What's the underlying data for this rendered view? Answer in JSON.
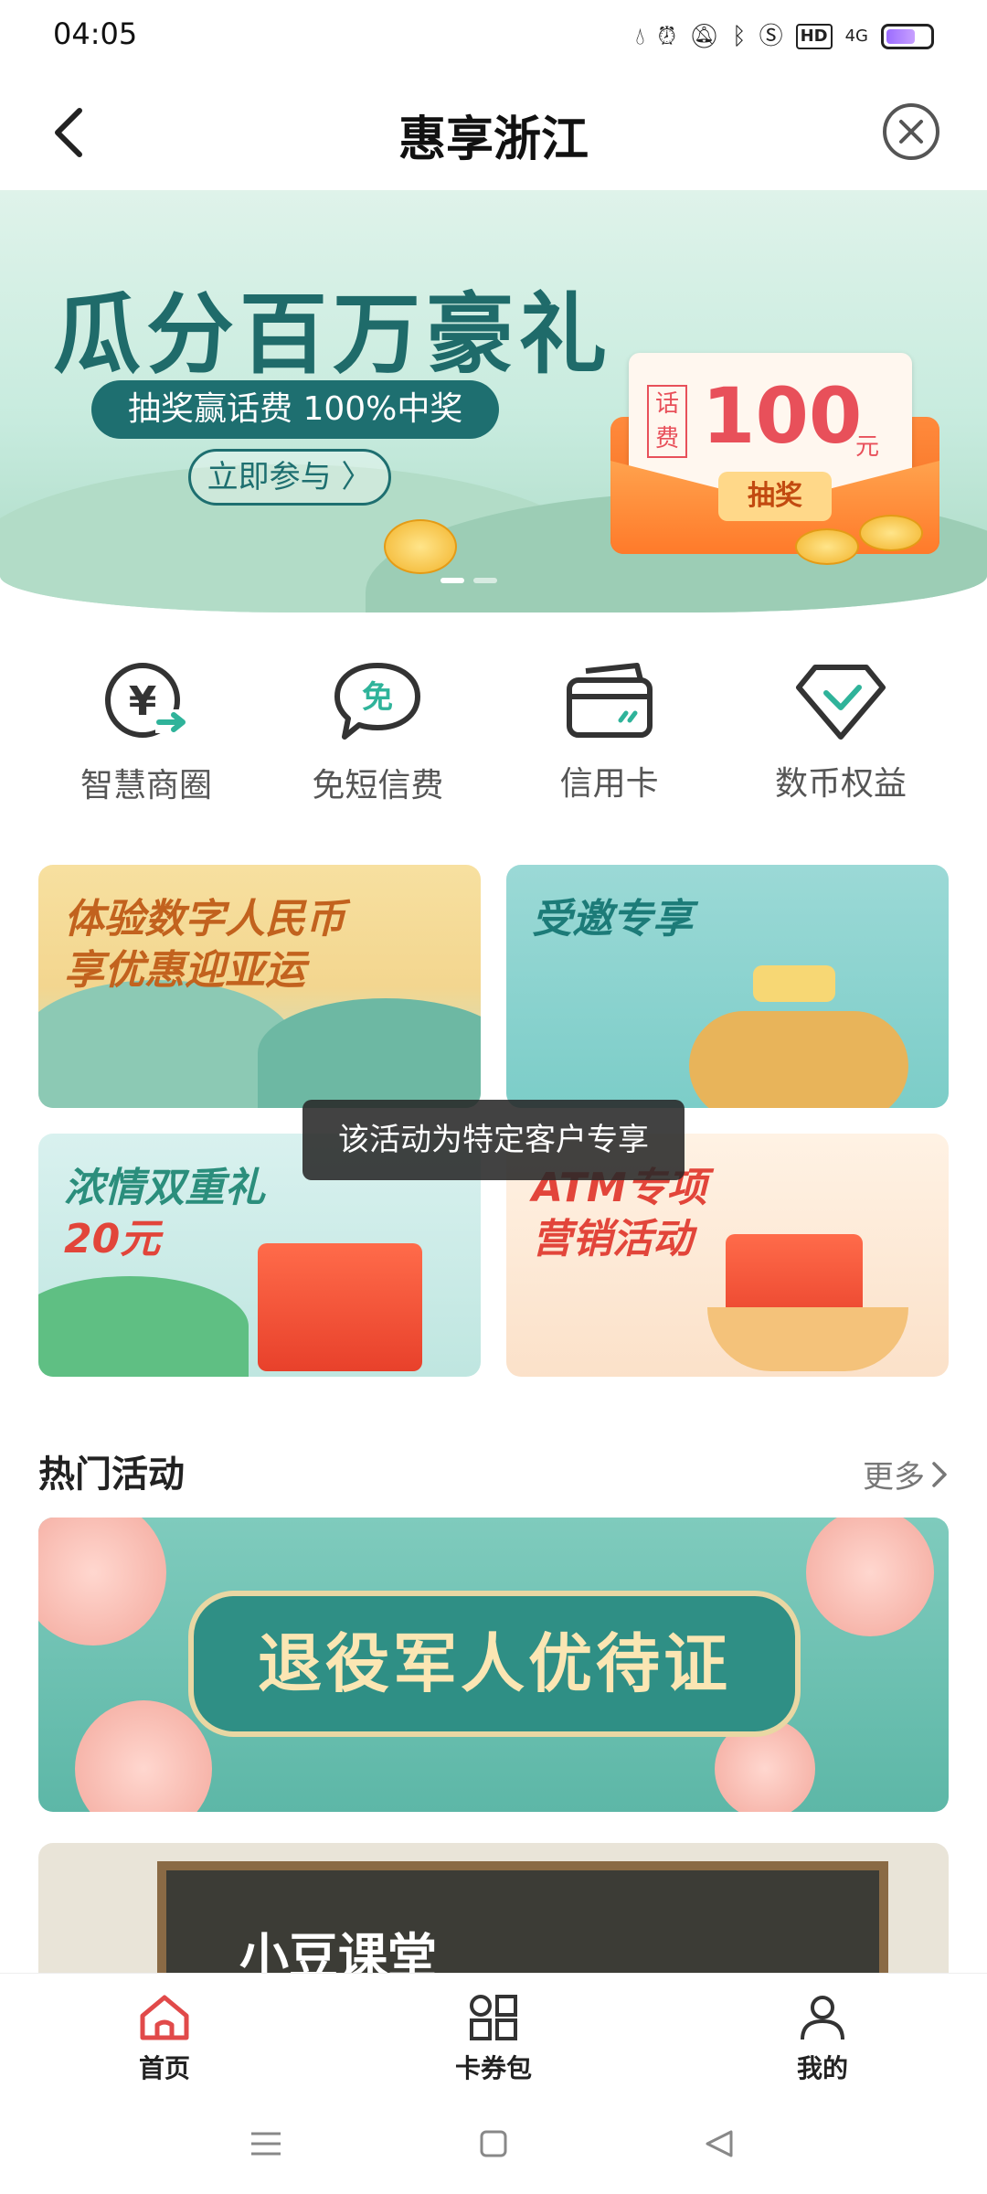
{
  "status_bar": {
    "time": "04:05",
    "network": "4G"
  },
  "nav": {
    "title": "惠享浙江"
  },
  "hero": {
    "title": "瓜分百万豪礼",
    "subtitle": "抽奖赢话费 100%中奖",
    "cta": "立即参与 〉",
    "voucher_tag": "话费",
    "voucher_amount": "100",
    "voucher_unit": "元",
    "voucher_button": "抽奖",
    "active_dot": 0
  },
  "quick_entries": [
    {
      "label": "智慧商圈",
      "icon": "yuan-arrow-icon"
    },
    {
      "label": "免短信费",
      "icon": "free-sms-icon"
    },
    {
      "label": "信用卡",
      "icon": "credit-card-icon"
    },
    {
      "label": "数币权益",
      "icon": "diamond-icon"
    }
  ],
  "promo_cards": [
    {
      "line1": "体验数字人民币",
      "line2": "享优惠迎亚运"
    },
    {
      "line1": "受邀专享",
      "line2": ""
    },
    {
      "line1": "浓情双重礼",
      "line2": "20元"
    },
    {
      "line1": "ATM专项",
      "line2": "营销活动"
    }
  ],
  "toast": "该活动为特定客户专享",
  "hot_section": {
    "title": "热门活动",
    "more": "更多",
    "banner1_text": "退役军人优待证",
    "banner2_text": "小豆课堂"
  },
  "tabbar": [
    {
      "label": "首页",
      "icon": "home-icon",
      "active": true
    },
    {
      "label": "卡券包",
      "icon": "grid-icon",
      "active": false
    },
    {
      "label": "我的",
      "icon": "profile-icon",
      "active": false
    }
  ],
  "colors": {
    "accent": "#e14a4a",
    "teal": "#1e6f70"
  }
}
